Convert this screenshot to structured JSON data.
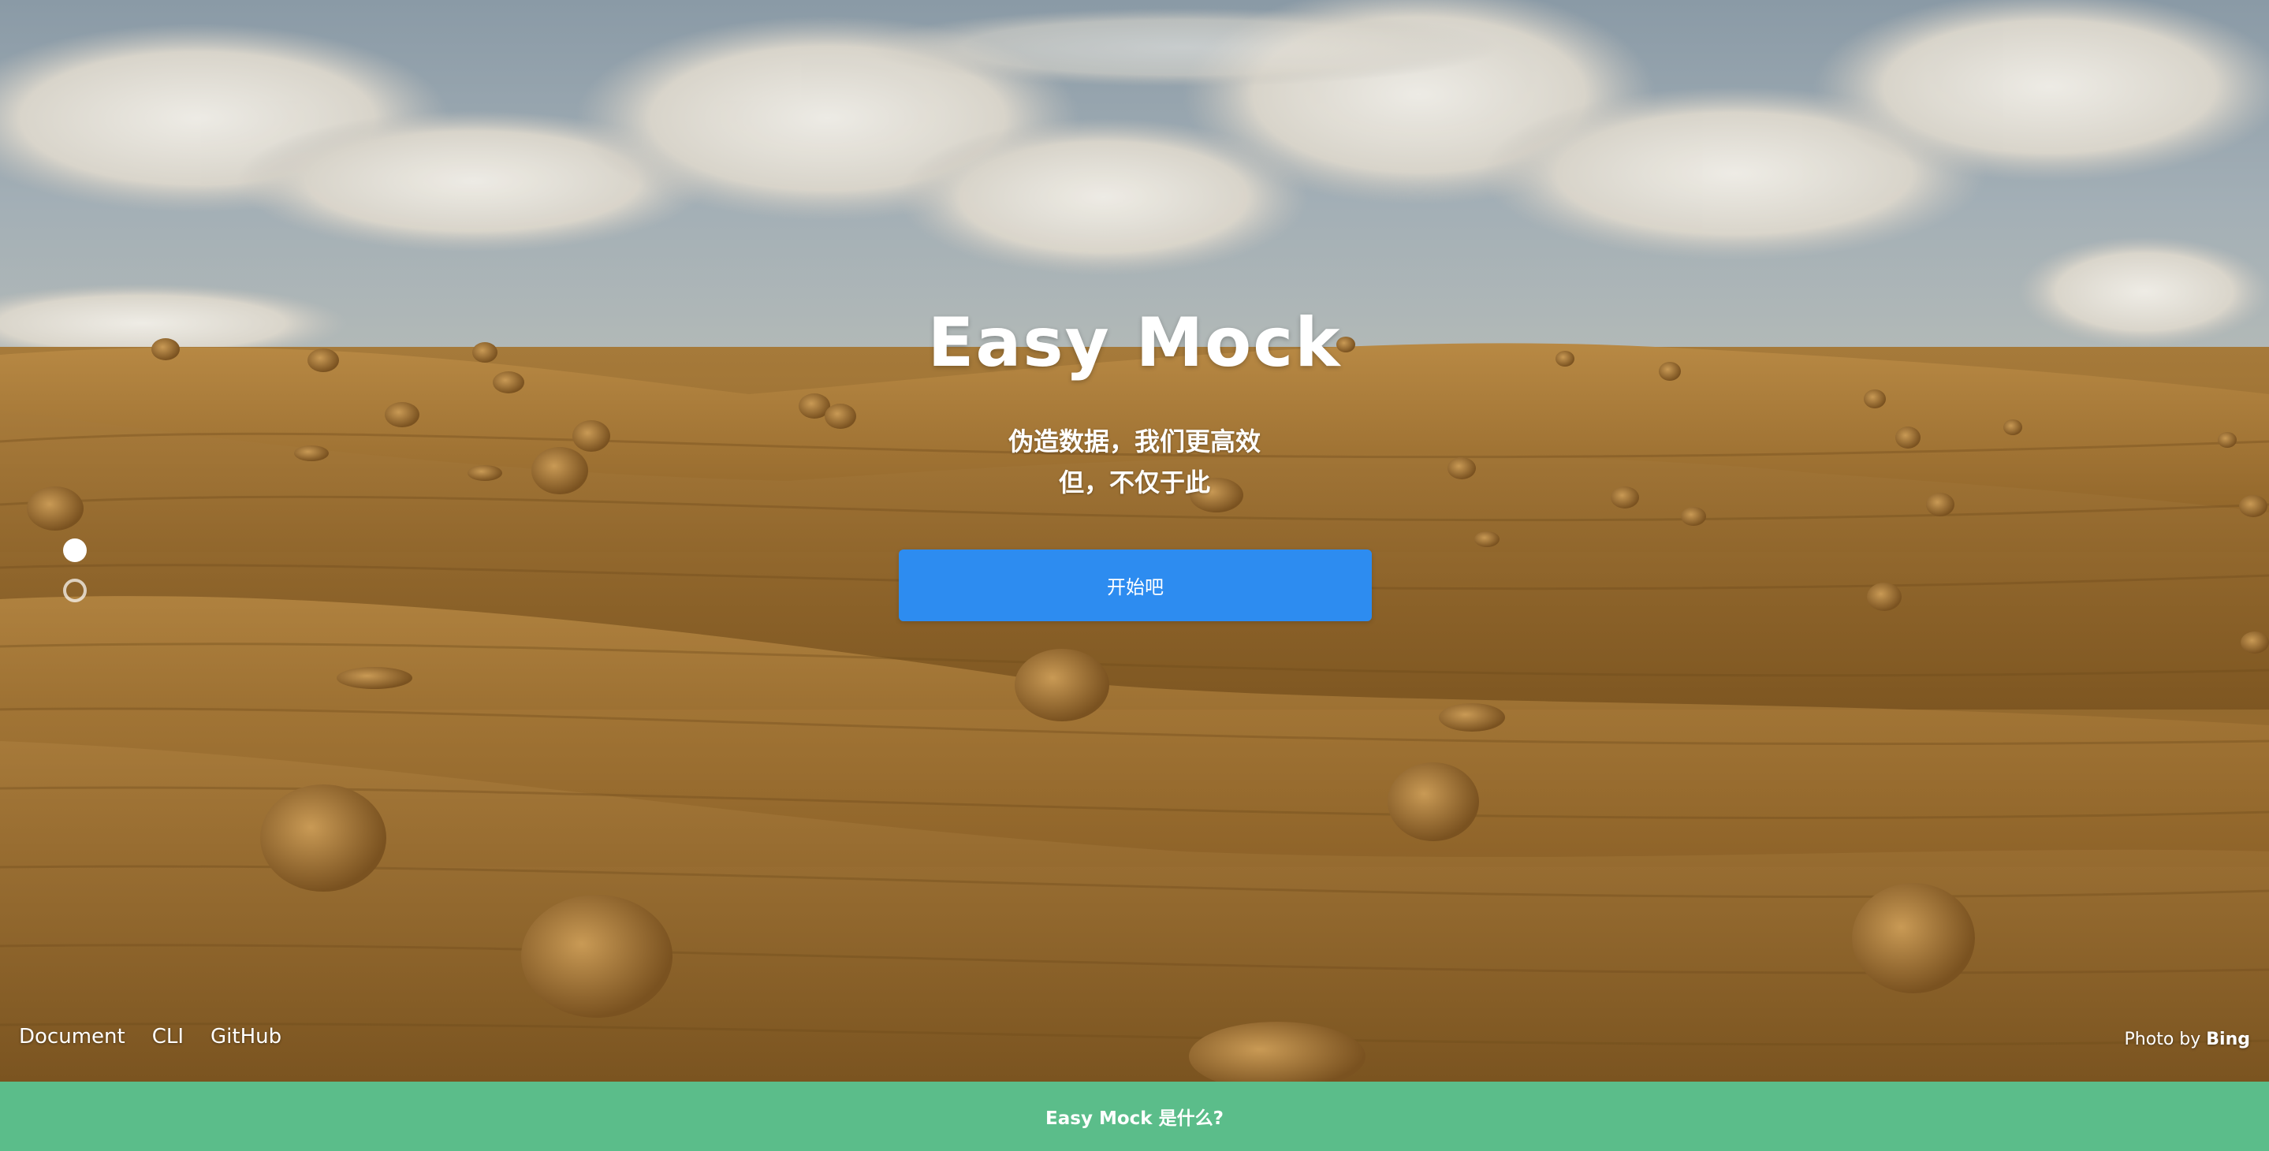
{
  "hero": {
    "title": "Easy Mock",
    "subtitle_line1": "伪造数据，我们更高效",
    "subtitle_line2": "但，不仅于此",
    "start_button_label": "开始吧"
  },
  "footer": {
    "links": [
      "Document",
      "CLI",
      "GitHub"
    ],
    "photo_credit_prefix": "Photo by",
    "photo_credit_source": "Bing"
  },
  "bottom_bar": {
    "label": "Easy Mock 是什么?"
  },
  "slides": {
    "count": 2,
    "active_index": 0
  },
  "colors": {
    "primary_button": "#2d8cf0",
    "bottom_bar": "#5bbd8a"
  },
  "icons": [
    "slide-dot-active",
    "slide-dot-inactive"
  ]
}
